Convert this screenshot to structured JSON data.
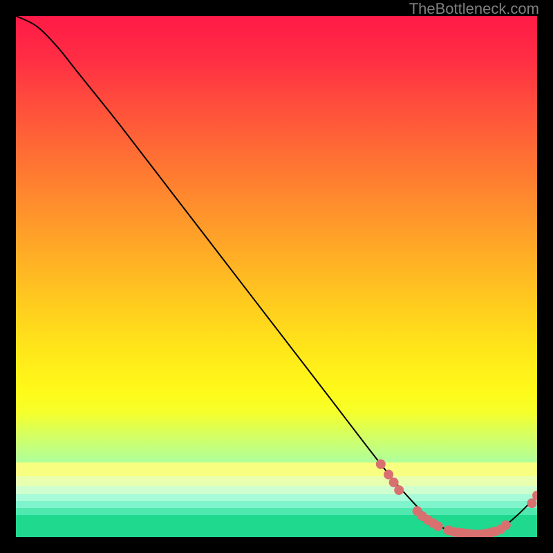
{
  "watermark": "TheBottleneck.com",
  "chart_data": {
    "type": "line",
    "title": "",
    "xlabel": "",
    "ylabel": "",
    "xlim": [
      0,
      100
    ],
    "ylim": [
      0,
      100
    ],
    "series": [
      {
        "name": "curve",
        "x": [
          0,
          4,
          8,
          12,
          20,
          30,
          40,
          50,
          60,
          70,
          75,
          80,
          84,
          88,
          92,
          96,
          100
        ],
        "y": [
          100,
          98,
          94,
          89,
          79,
          66,
          53,
          40,
          27,
          14,
          8,
          3,
          1,
          0.5,
          1,
          4,
          8
        ]
      }
    ],
    "markers": {
      "name": "data-points",
      "color": "#d97070",
      "points": [
        {
          "x": 70,
          "y": 14
        },
        {
          "x": 71.5,
          "y": 12
        },
        {
          "x": 72.5,
          "y": 10.5
        },
        {
          "x": 73.5,
          "y": 9
        },
        {
          "x": 77,
          "y": 5
        },
        {
          "x": 78,
          "y": 4
        },
        {
          "x": 79,
          "y": 3.3
        },
        {
          "x": 80,
          "y": 2.7
        },
        {
          "x": 81,
          "y": 2.1
        },
        {
          "x": 83,
          "y": 1.3
        },
        {
          "x": 84,
          "y": 1
        },
        {
          "x": 84.8,
          "y": 0.9
        },
        {
          "x": 85.6,
          "y": 0.8
        },
        {
          "x": 86.4,
          "y": 0.7
        },
        {
          "x": 87.2,
          "y": 0.6
        },
        {
          "x": 88,
          "y": 0.5
        },
        {
          "x": 88.8,
          "y": 0.5
        },
        {
          "x": 89.6,
          "y": 0.6
        },
        {
          "x": 90.4,
          "y": 0.7
        },
        {
          "x": 91.2,
          "y": 0.9
        },
        {
          "x": 92,
          "y": 1.1
        },
        {
          "x": 93,
          "y": 1.5
        },
        {
          "x": 94,
          "y": 2.3
        },
        {
          "x": 99,
          "y": 6.5
        },
        {
          "x": 100,
          "y": 8
        }
      ]
    },
    "gradient_bands": [
      {
        "y": 0,
        "color": "#ff1a47"
      },
      {
        "y": 50,
        "color": "#ffce1e"
      },
      {
        "y": 75,
        "color": "#fffa19"
      },
      {
        "y": 90,
        "color": "#7effd4"
      },
      {
        "y": 100,
        "color": "#1fd98f"
      }
    ]
  }
}
